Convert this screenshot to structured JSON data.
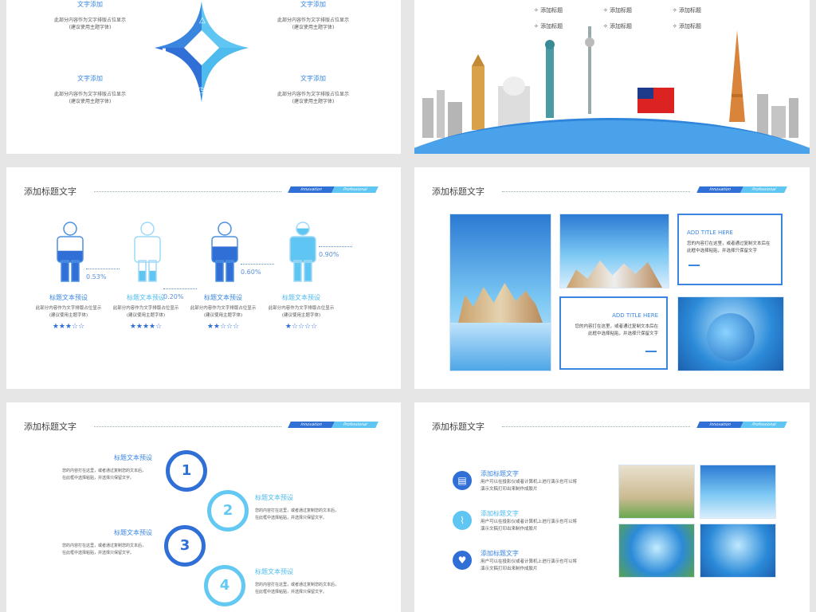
{
  "slide1": {
    "heading_tl": "文字添加",
    "heading_tr": "文字添加",
    "heading_bl": "文字添加",
    "heading_br": "文字添加",
    "body_a": "此部分内容作为文字排版占位显示",
    "body_b": "(建议使用主题字体)"
  },
  "slide2": {
    "menu": [
      "添加标题",
      "添加标题",
      "添加标题",
      "添加标题",
      "添加标题",
      "添加标题"
    ]
  },
  "common": {
    "title": "添加标题文字",
    "tag1": "Innovation",
    "tag2": "Professional"
  },
  "slide3": {
    "people": [
      {
        "pct": "0.53%",
        "label": "标题文本预设",
        "stars": "★★★☆☆",
        "fill": 0.53
      },
      {
        "pct": "0.20%",
        "label": "标题文本预设",
        "stars": "★★★★☆",
        "fill": 0.2
      },
      {
        "pct": "0.60%",
        "label": "标题文本预设",
        "stars": "★★☆☆☆",
        "fill": 0.6
      },
      {
        "pct": "0.90%",
        "label": "标题文本预设",
        "stars": "★☆☆☆☆",
        "fill": 0.9
      }
    ],
    "body_a": "此部分内容作为文字排版占位显示",
    "body_b": "(建议使用主题字体)"
  },
  "slide4": {
    "box_title": "ADD TITLE HERE",
    "box_body_a": "您的内容打在这里，或者通过复制文本后在",
    "box_body_b": "此框中选择粘贴，并选择只保留文字"
  },
  "slide5": {
    "items": [
      {
        "num": "1",
        "label": "标题文本预设"
      },
      {
        "num": "2",
        "label": "标题文本预设"
      },
      {
        "num": "3",
        "label": "标题文本预设"
      },
      {
        "num": "4",
        "label": "标题文本预设"
      }
    ],
    "body_a": "您的内容打在这里，或者通过复制您的文本后，",
    "body_b": "在此框中选择粘贴，并选择只保留文字。"
  },
  "slide6": {
    "items": [
      {
        "title": "添加标题文字",
        "icon": "document-icon"
      },
      {
        "title": "添加标题文字",
        "icon": "chart-icon"
      },
      {
        "title": "添加标题文字",
        "icon": "heart-icon"
      }
    ],
    "body_a": "用户可以在投影仪或者计算机上进行演示也可以将",
    "body_b": "演示文稿打印出来制作成胶片"
  }
}
